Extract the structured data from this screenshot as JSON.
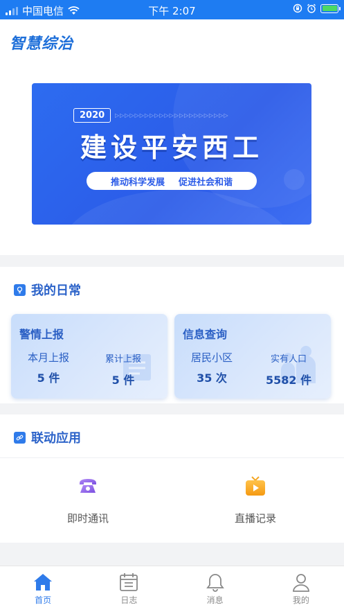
{
  "status_bar": {
    "carrier": "中国电信",
    "time": "下午 2:07"
  },
  "app": {
    "title": "智慧综治"
  },
  "banner": {
    "year": "2020",
    "title": "建设平安西工",
    "slogan_left": "推动科学发展",
    "slogan_right": "促进社会和谐"
  },
  "daily": {
    "heading": "我的日常",
    "cards": [
      {
        "title": "警情上报",
        "stats": [
          {
            "label": "本月上报",
            "value": "5 件"
          },
          {
            "label": "累计上报",
            "value": "5 件"
          }
        ]
      },
      {
        "title": "信息查询",
        "stats": [
          {
            "label": "居民小区",
            "value": "35 次"
          },
          {
            "label": "实有人口",
            "value": "5582 件"
          }
        ]
      }
    ]
  },
  "linkage": {
    "heading": "联动应用",
    "apps": [
      {
        "label": "即时通讯",
        "icon": "telephone-icon"
      },
      {
        "label": "直播记录",
        "icon": "tv-play-icon"
      }
    ]
  },
  "tabbar": {
    "tabs": [
      {
        "label": "首页",
        "icon": "home-icon",
        "active": true
      },
      {
        "label": "日志",
        "icon": "calendar-icon"
      },
      {
        "label": "消息",
        "icon": "bell-icon"
      },
      {
        "label": "我的",
        "icon": "user-icon"
      }
    ]
  },
  "colors": {
    "primary": "#2f7bea",
    "status_bar": "#1e7cf2",
    "banner": "#2b5be8",
    "card_text": "#2a5fc4"
  }
}
